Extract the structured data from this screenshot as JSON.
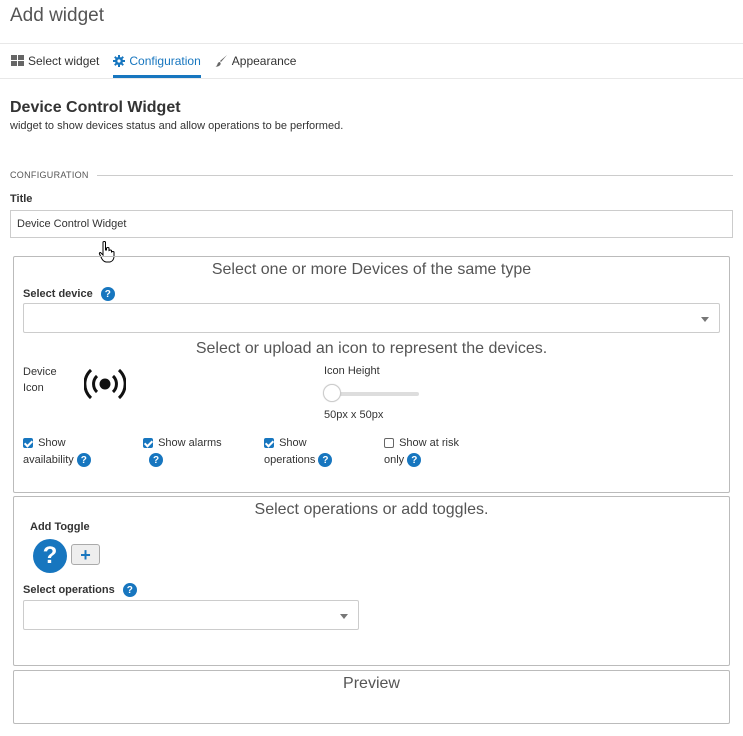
{
  "header": {
    "title": "Add widget"
  },
  "tabs": [
    {
      "label": "Select widget",
      "icon": "grid-icon"
    },
    {
      "label": "Configuration",
      "icon": "gear-icon",
      "active": true
    },
    {
      "label": "Appearance",
      "icon": "brush-icon"
    }
  ],
  "widget": {
    "name": "Device Control Widget",
    "description": "widget to show devices status and allow operations to be performed."
  },
  "configuration": {
    "section_label": "CONFIGURATION",
    "title_label": "Title",
    "title_value": "Device Control Widget"
  },
  "devices_panel": {
    "heading": "Select one or more Devices of the same type",
    "select_device_label": "Select device",
    "icon_heading": "Select or upload an icon to represent the devices.",
    "device_icon_label_line1": "Device",
    "device_icon_label_line2": "Icon",
    "icon_height_label": "Icon Height",
    "icon_height_value": "50px x 50px",
    "icon_height_slider_fraction": 0,
    "checkboxes": [
      {
        "line1": "Show",
        "line2": "availability",
        "checked": true
      },
      {
        "line1": "Show alarms",
        "line2": "",
        "checked": true
      },
      {
        "line1": "Show",
        "line2": "operations",
        "checked": true
      },
      {
        "line1": "Show at risk",
        "line2": "only",
        "checked": false
      }
    ]
  },
  "operations_panel": {
    "heading": "Select operations or add toggles.",
    "add_toggle_label": "Add Toggle",
    "toggle_placeholder_icon": "?",
    "add_button_icon": "+",
    "select_operations_label": "Select operations"
  },
  "preview_panel": {
    "heading": "Preview"
  },
  "help_icon_glyph": "?",
  "colors": {
    "accent": "#1776bf"
  }
}
